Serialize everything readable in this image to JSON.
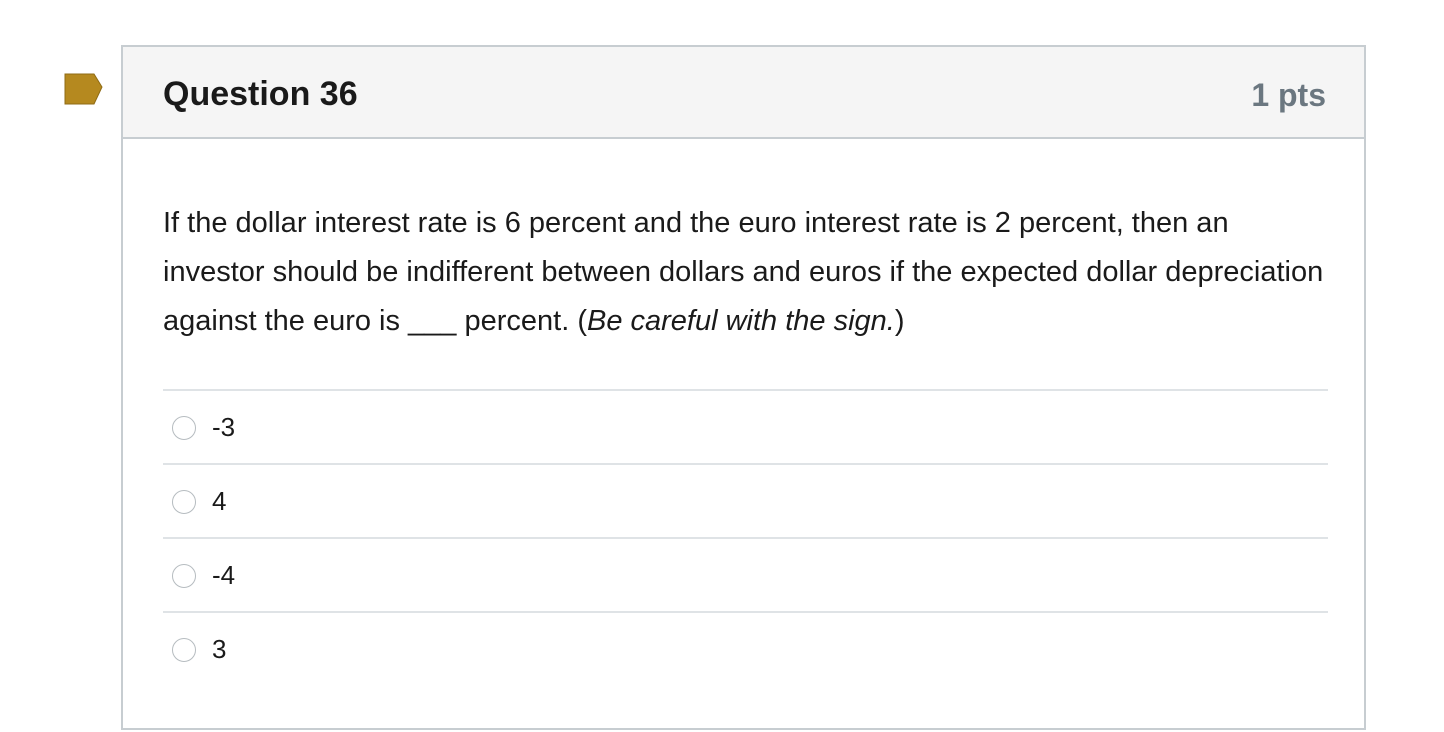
{
  "flag": {
    "icon": "flag-icon",
    "color": "#b5891f"
  },
  "question": {
    "title": "Question 36",
    "points": "1 pts",
    "text_main": "If the dollar interest rate is 6 percent and the euro interest rate is 2 percent, then an investor should be indifferent between dollars and euros if the expected dollar depreciation against the euro is ___ percent. (",
    "text_italic": "Be careful with the sign.",
    "text_end": ")"
  },
  "answers": [
    {
      "label": "-3"
    },
    {
      "label": "4"
    },
    {
      "label": "-4"
    },
    {
      "label": "3"
    }
  ]
}
